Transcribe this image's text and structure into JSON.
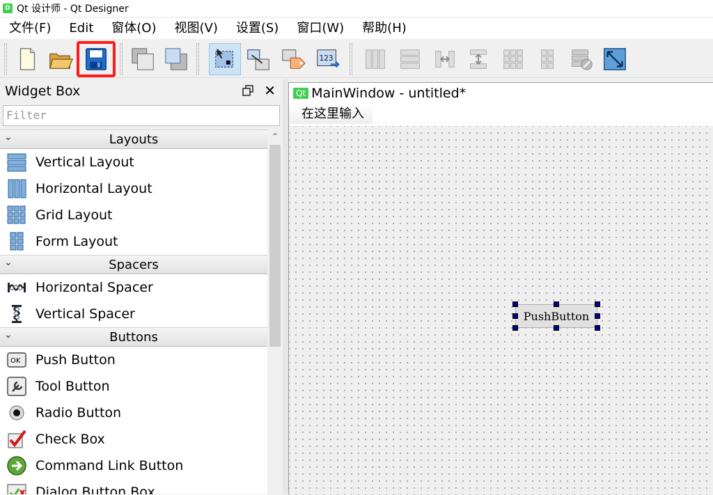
{
  "window": {
    "title": "Qt 设计师 - Qt Designer"
  },
  "menubar": [
    "文件(F)",
    "Edit",
    "窗体(O)",
    "视图(V)",
    "设置(S)",
    "窗口(W)",
    "帮助(H)"
  ],
  "widget_box": {
    "title": "Widget Box",
    "filter_placeholder": "Filter",
    "categories": [
      {
        "name": "Layouts",
        "items": [
          "Vertical Layout",
          "Horizontal Layout",
          "Grid Layout",
          "Form Layout"
        ]
      },
      {
        "name": "Spacers",
        "items": [
          "Horizontal Spacer",
          "Vertical Spacer"
        ]
      },
      {
        "name": "Buttons",
        "items": [
          "Push Button",
          "Tool Button",
          "Radio Button",
          "Check Box",
          "Command Link Button",
          "Dialog Button Box"
        ]
      }
    ]
  },
  "form": {
    "badge": "Qt",
    "title": "MainWindow - untitled*",
    "menu_placeholder": "在这里输入",
    "push_button_label": "PushButton"
  },
  "colors": {
    "highlight": "#ff1a1a",
    "handle": "#000080",
    "qt_green": "#41cd52"
  }
}
